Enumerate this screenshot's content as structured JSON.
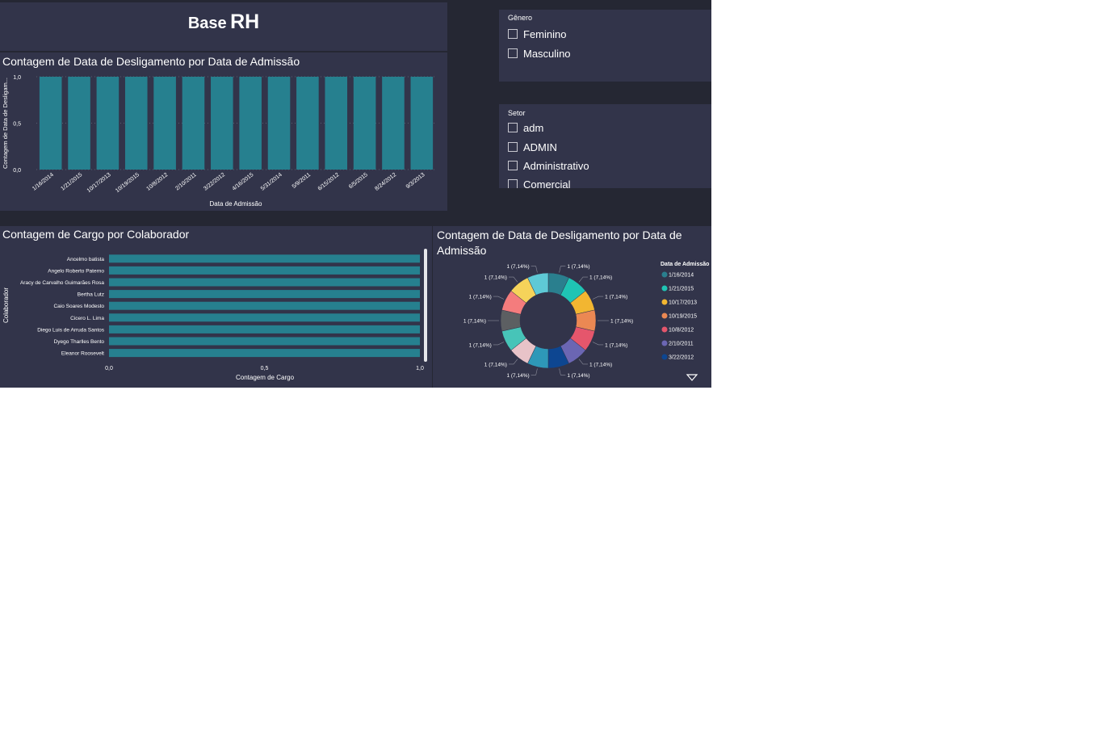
{
  "header": {
    "title_small": "Base",
    "title_big": "RH"
  },
  "filters": {
    "genero": {
      "label": "Gênero",
      "options": [
        "Feminino",
        "Masculino"
      ]
    },
    "setor": {
      "label": "Setor",
      "options": [
        "adm",
        "ADMIN",
        "Administrativo",
        "Comercial"
      ]
    }
  },
  "colors": {
    "bar": "#26808f",
    "card": "#32344a",
    "background": "#252733"
  },
  "chart_data": [
    {
      "type": "bar",
      "title": "Contagem de Data de Desligamento por Data de Admissão",
      "xlabel": "Data de Admissão",
      "ylabel": "Contagem de Data de Desligam...",
      "categories": [
        "1/16/2014",
        "1/21/2015",
        "10/17/2013",
        "10/19/2015",
        "10/8/2012",
        "2/10/2011",
        "3/22/2012",
        "4/16/2015",
        "5/31/2014",
        "5/9/2011",
        "6/15/2012",
        "6/5/2015",
        "8/24/2012",
        "9/3/2013"
      ],
      "values": [
        1,
        1,
        1,
        1,
        1,
        1,
        1,
        1,
        1,
        1,
        1,
        1,
        1,
        1
      ],
      "yticks": [
        "0,0",
        "0,5",
        "1,0"
      ],
      "ylim": [
        0,
        1
      ],
      "grid": true
    },
    {
      "type": "bar",
      "orientation": "horizontal",
      "title": "Contagem de Cargo por Colaborador",
      "xlabel": "Contagem de Cargo",
      "ylabel": "Colaborador",
      "categories": [
        "Ancelmo batista",
        "Angelo Roberto Paterno",
        "Aracy de Carvalho Guimarães Rosa",
        "Bertha Lutz",
        "Caio Soares Modesto",
        "Cicero L. Lima",
        "Diego Luis de Arruda Santos",
        "Dyego Tharlles Bento",
        "Eleanor Roosevelt"
      ],
      "values": [
        1,
        1,
        1,
        1,
        1,
        1,
        1,
        1,
        1
      ],
      "xticks": [
        "0,0",
        "0,5",
        "1,0"
      ],
      "xlim": [
        0,
        1
      ]
    },
    {
      "type": "pie",
      "donut": true,
      "title": "Contagem de Data de Desligamento por Data de Admissão",
      "legend_title": "Data de Admissão",
      "legend_position": "right",
      "labels": [
        "1/16/2014",
        "1/21/2015",
        "10/17/2013",
        "10/19/2015",
        "10/8/2012",
        "2/10/2011",
        "3/22/2012",
        "4/16/2015",
        "5/31/2014",
        "5/9/2011",
        "6/15/2012",
        "6/5/2015",
        "8/24/2012",
        "9/3/2013"
      ],
      "values": [
        1,
        1,
        1,
        1,
        1,
        1,
        1,
        1,
        1,
        1,
        1,
        1,
        1,
        1
      ],
      "data_labels": [
        "1 (7,14%)",
        "1 (7,14%)",
        "1 (7,14%)",
        "1 (7,14%)",
        "1 (7,14%)",
        "1 (7,14%)",
        "1 (7,14%)",
        "1 (7,14%)",
        "1 (7,14%)",
        "1 (7,14%)",
        "1 (7,14%)",
        "1 (7,14%)",
        "1 (7,14%)",
        "1 (7,14%)"
      ],
      "colors": [
        "#2a7f8e",
        "#1fc4b4",
        "#f2b631",
        "#eb8853",
        "#e5566c",
        "#6b66b3",
        "#0d4691",
        "#2e98b8",
        "#e8c3c8",
        "#47c4b8",
        "#5c5f62",
        "#f47c7d",
        "#f5d35a",
        "#5ec9d6"
      ],
      "legend_visible": [
        "1/16/2014",
        "1/21/2015",
        "10/17/2013",
        "10/19/2015",
        "10/8/2012",
        "2/10/2011",
        "3/22/2012"
      ]
    }
  ]
}
